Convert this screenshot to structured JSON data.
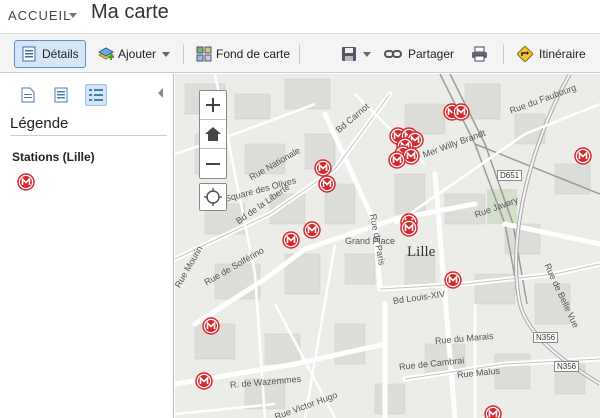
{
  "header": {
    "home_label": "ACCUEIL",
    "map_title": "Ma carte"
  },
  "toolbar": {
    "details_label": "Détails",
    "add_label": "Ajouter",
    "basemap_label": "Fond de carte",
    "share_label": "Partager",
    "directions_label": "Itinéraire"
  },
  "panel": {
    "legend_title": "Légende",
    "layer_title": "Stations (Lille)",
    "active_tab": "legend-icon"
  },
  "map": {
    "city_label": "Lille",
    "streets": [
      "Rue Nationale",
      "Bd de la Liberté",
      "Rue de Solférino",
      "Bd Carnot",
      "Rue du Faubourg",
      "Bd Louis-XIV",
      "Rue de Cambrai",
      "R. de Wazemmes",
      "Rue Victor Hugo",
      "Rue de Paris",
      "Rue Javary",
      "Rue de Belle Vue",
      "Rue Malus",
      "Rue du Marais",
      "Mer Willy Brandt",
      "Grand Place",
      "Square des Olives",
      "Rue Mourin"
    ],
    "road_shields": [
      "D651",
      "N356",
      "N356"
    ],
    "symbol": "metro-station-icon"
  },
  "colors": {
    "accent": "#5a8fc8",
    "station_red": "#d7282f",
    "map_bg": "#ecece9"
  }
}
